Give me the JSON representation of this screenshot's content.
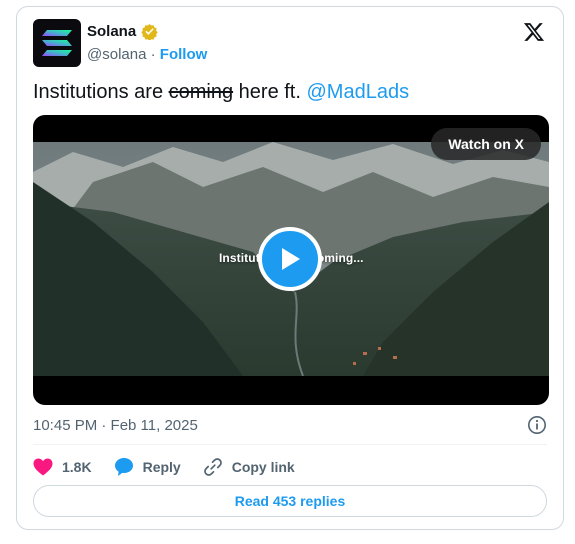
{
  "author": {
    "name": "Solana",
    "handle": "@solana",
    "separator": "·",
    "follow_label": "Follow"
  },
  "tweet": {
    "text_before": "Institutions are ",
    "strikethrough": "coming",
    "text_after": " here ft. ",
    "mention": "@MadLads"
  },
  "media": {
    "watch_label": "Watch on X",
    "caption": "Institutions are coming..."
  },
  "meta": {
    "timestamp": "10:45 PM · Feb 11, 2025"
  },
  "actions": {
    "likes": "1.8K",
    "reply_label": "Reply",
    "copy_link_label": "Copy link"
  },
  "read_replies_label": "Read 453 replies",
  "colors": {
    "accent": "#1d9bf0",
    "like": "#f91880",
    "verified": "#e2b719"
  },
  "icons": [
    "solana-logo",
    "verified-badge-icon",
    "x-logo-icon",
    "play-icon",
    "info-icon",
    "heart-icon",
    "reply-bubble-icon",
    "link-icon"
  ]
}
